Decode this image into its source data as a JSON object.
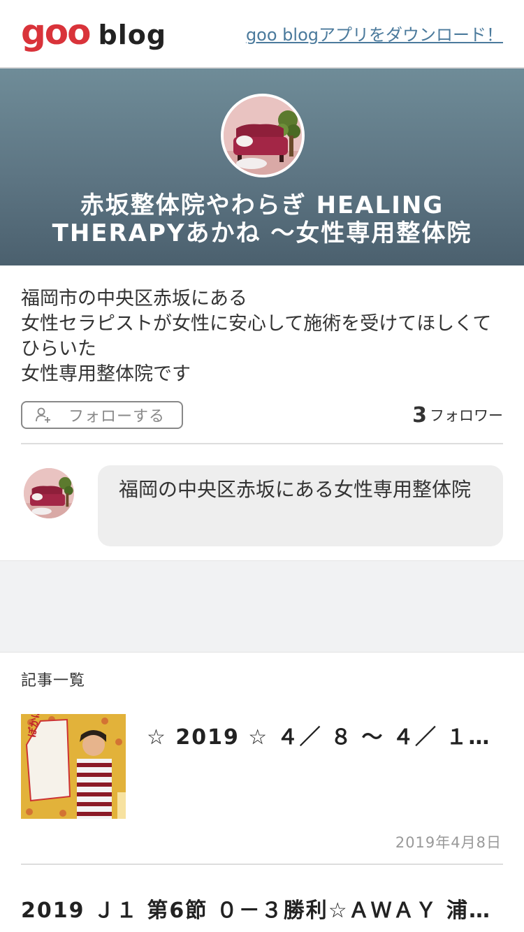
{
  "header": {
    "logo_goo": "goo",
    "logo_blog": "blog",
    "download_link": "goo blogアプリをダウンロード！"
  },
  "hero": {
    "title_line1": "赤坂整体院やわらぎ HEALING",
    "title_line2": "THERAPYあかね ～女性専用整体院"
  },
  "profile": {
    "description_lines": [
      "福岡市の中央区赤坂にある",
      "女性セラピストが女性に安心して施術を受けてほしくて ひらいた",
      "女性専用整体院です"
    ],
    "follow_button": "フォローする",
    "follower_count": "3",
    "follower_unit": "フォロワー"
  },
  "message": {
    "text": "福岡の中央区赤坂にある女性専用整体院"
  },
  "articles": {
    "section_label": "記事一覧",
    "items": [
      {
        "title": "☆ 2019 ☆ ４／ ８ ～ ４／ １…",
        "date": "2019年4月8日",
        "thumb_text": "ぽかぽか春吉"
      },
      {
        "title": "2019 Ｊ１ 第6節 ０－３勝利☆ＡＷＡＹ 浦…"
      }
    ]
  },
  "colors": {
    "brand_red": "#d9333a",
    "link_blue": "#4b7a9c",
    "hero_top": "#6f8c98",
    "hero_bottom": "#4b606e"
  }
}
